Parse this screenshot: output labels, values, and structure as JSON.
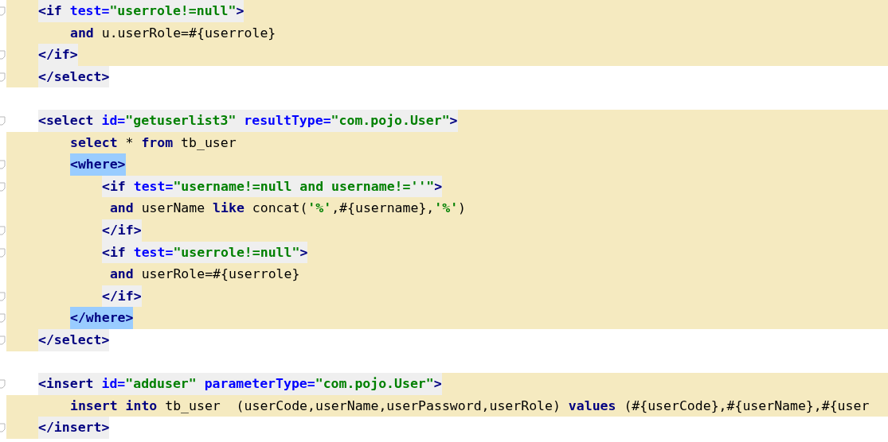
{
  "editor": {
    "lines": [
      {
        "kind": "inside",
        "fold": true,
        "matched": false,
        "tokens": [
          {
            "kind": "tag",
            "text": "<if"
          },
          {
            "kind": "attr",
            "text": " test="
          },
          {
            "kind": "value",
            "text": "\"userrole!=null\""
          },
          {
            "kind": "tag",
            "text": ">"
          }
        ],
        "children": [
          {
            "kind": "inside",
            "fold": false,
            "matched": false,
            "tokens": [
              {
                "kind": "keyword",
                "text": "and"
              },
              {
                "kind": "text",
                "text": " u.userRole=#{userrole}"
              }
            ]
          }
        ]
      },
      {
        "kind": "inside",
        "fold": true,
        "matched": false,
        "tokens": [
          {
            "kind": "tag",
            "text": "</if>"
          }
        ]
      },
      {
        "kind": "closing",
        "fold": true,
        "matched": false,
        "tokens": [
          {
            "kind": "tag",
            "text": "</select>"
          }
        ]
      },
      {
        "kind": "outside",
        "fold": false
      },
      {
        "kind": "opening",
        "fold": true,
        "matched": false,
        "tokens": [
          {
            "kind": "tag",
            "text": "<select"
          },
          {
            "kind": "attr",
            "text": " id="
          },
          {
            "kind": "value",
            "text": "\"getuserlist3\""
          },
          {
            "kind": "attr",
            "text": " resultType="
          },
          {
            "kind": "value",
            "text": "\"com.pojo.User\""
          },
          {
            "kind": "tag",
            "text": ">"
          }
        ],
        "children": [
          {
            "kind": "inside",
            "fold": false,
            "matched": false,
            "tokens": [
              {
                "kind": "keyword",
                "text": "select"
              },
              {
                "kind": "text",
                "text": " * "
              },
              {
                "kind": "keyword",
                "text": "from"
              },
              {
                "kind": "text",
                "text": " tb_user"
              }
            ]
          },
          {
            "kind": "inside",
            "fold": true,
            "matched": true,
            "tokens": [
              {
                "kind": "tag",
                "text": "<where>"
              }
            ],
            "children": [
              {
                "kind": "inside",
                "fold": true,
                "matched": false,
                "tokens": [
                  {
                    "kind": "tag",
                    "text": "<if"
                  },
                  {
                    "kind": "attr",
                    "text": " test="
                  },
                  {
                    "kind": "value",
                    "text": "\"username!=null and username!=''\""
                  },
                  {
                    "kind": "tag",
                    "text": ">"
                  }
                ]
              },
              {
                "kind": "inside",
                "fold": false,
                "matched": false,
                "tokens": [
                  {
                    "kind": "keyword",
                    "text": " and"
                  },
                  {
                    "kind": "text",
                    "text": " userName "
                  },
                  {
                    "kind": "keyword",
                    "text": "like"
                  },
                  {
                    "kind": "text",
                    "text": " concat("
                  },
                  {
                    "kind": "value",
                    "text": "'%'"
                  },
                  {
                    "kind": "text",
                    "text": ",#{username},"
                  },
                  {
                    "kind": "value",
                    "text": "'%'"
                  },
                  {
                    "kind": "text",
                    "text": ")"
                  }
                ]
              },
              {
                "kind": "inside",
                "fold": true,
                "matched": false,
                "tokens": [
                  {
                    "kind": "tag",
                    "text": "</if>"
                  }
                ]
              },
              {
                "kind": "inside",
                "fold": true,
                "matched": false,
                "tokens": [
                  {
                    "kind": "tag",
                    "text": "<if"
                  },
                  {
                    "kind": "attr",
                    "text": " test="
                  },
                  {
                    "kind": "value",
                    "text": "\"userrole!=null\""
                  },
                  {
                    "kind": "tag",
                    "text": ">"
                  }
                ]
              },
              {
                "kind": "inside",
                "fold": false,
                "matched": false,
                "tokens": [
                  {
                    "kind": "keyword",
                    "text": " and"
                  },
                  {
                    "kind": "text",
                    "text": " userRole=#{userrole}"
                  }
                ]
              },
              {
                "kind": "inside",
                "fold": true,
                "matched": false,
                "tokens": [
                  {
                    "kind": "tag",
                    "text": "</if>"
                  }
                ]
              }
            ]
          },
          {
            "kind": "inside",
            "fold": true,
            "matched": true,
            "tokens": [
              {
                "kind": "tag",
                "text": "</where>"
              }
            ]
          }
        ]
      },
      {
        "kind": "closing",
        "fold": true,
        "matched": false,
        "tokens": [
          {
            "kind": "tag",
            "text": "</select>"
          }
        ]
      },
      {
        "kind": "outside",
        "fold": false
      },
      {
        "kind": "opening",
        "fold": true,
        "matched": false,
        "tokens": [
          {
            "kind": "tag",
            "text": "<insert"
          },
          {
            "kind": "attr",
            "text": " id="
          },
          {
            "kind": "value",
            "text": "\"adduser\""
          },
          {
            "kind": "attr",
            "text": " parameterType="
          },
          {
            "kind": "value",
            "text": "\"com.pojo.User\""
          },
          {
            "kind": "tag",
            "text": ">"
          }
        ],
        "children": [
          {
            "kind": "inside",
            "fold": false,
            "matched": false,
            "tokens": [
              {
                "kind": "keyword",
                "text": "insert"
              },
              {
                "kind": "keyword",
                "text": " into"
              },
              {
                "kind": "text",
                "text": " tb_user  (userCode,userName,userPassword,userRole) "
              },
              {
                "kind": "keyword",
                "text": "values"
              },
              {
                "kind": "text",
                "text": " (#{userCode},#{userName},#{user"
              }
            ]
          }
        ]
      },
      {
        "kind": "closing",
        "fold": true,
        "matched": false,
        "tokens": [
          {
            "kind": "tag",
            "text": "</insert>"
          }
        ]
      }
    ]
  }
}
